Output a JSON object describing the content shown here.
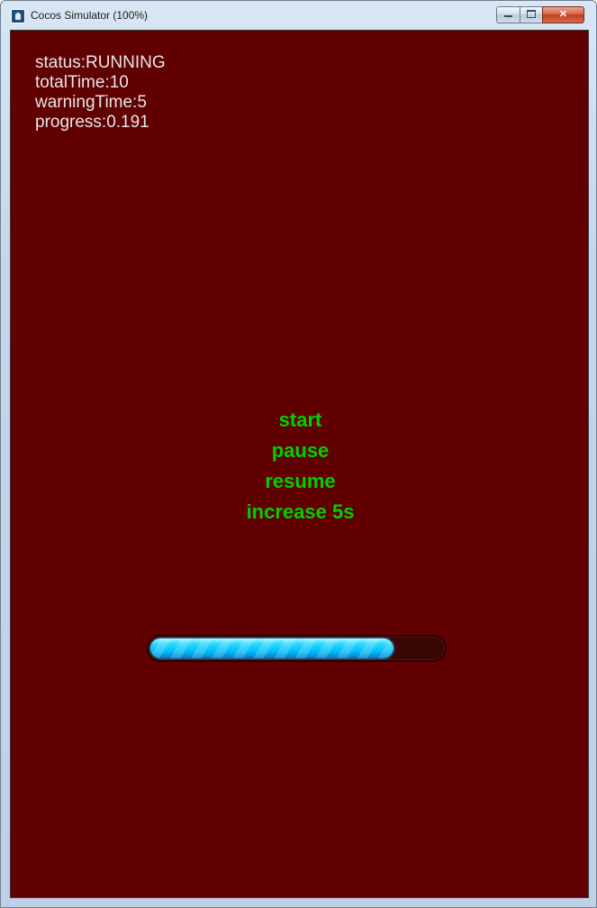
{
  "window": {
    "title": "Cocos Simulator (100%)",
    "controls": {
      "minimize": "minimize",
      "maximize": "maximize",
      "close": "✕"
    }
  },
  "info": {
    "status": "status:RUNNING",
    "total_time": "totalTime:10",
    "warning_time": "warningTime:5",
    "progress": "progress:0.191"
  },
  "menu": {
    "start": "start",
    "pause": "pause",
    "resume": "resume",
    "increase": "increase 5s"
  },
  "progress_bar": {
    "fill_fraction": 0.83,
    "fill_color": "#00c8ff",
    "track_color": "#3a0505"
  },
  "colors": {
    "background": "#600000",
    "menu_text": "#00d000",
    "info_text": "#e6e6e6"
  }
}
